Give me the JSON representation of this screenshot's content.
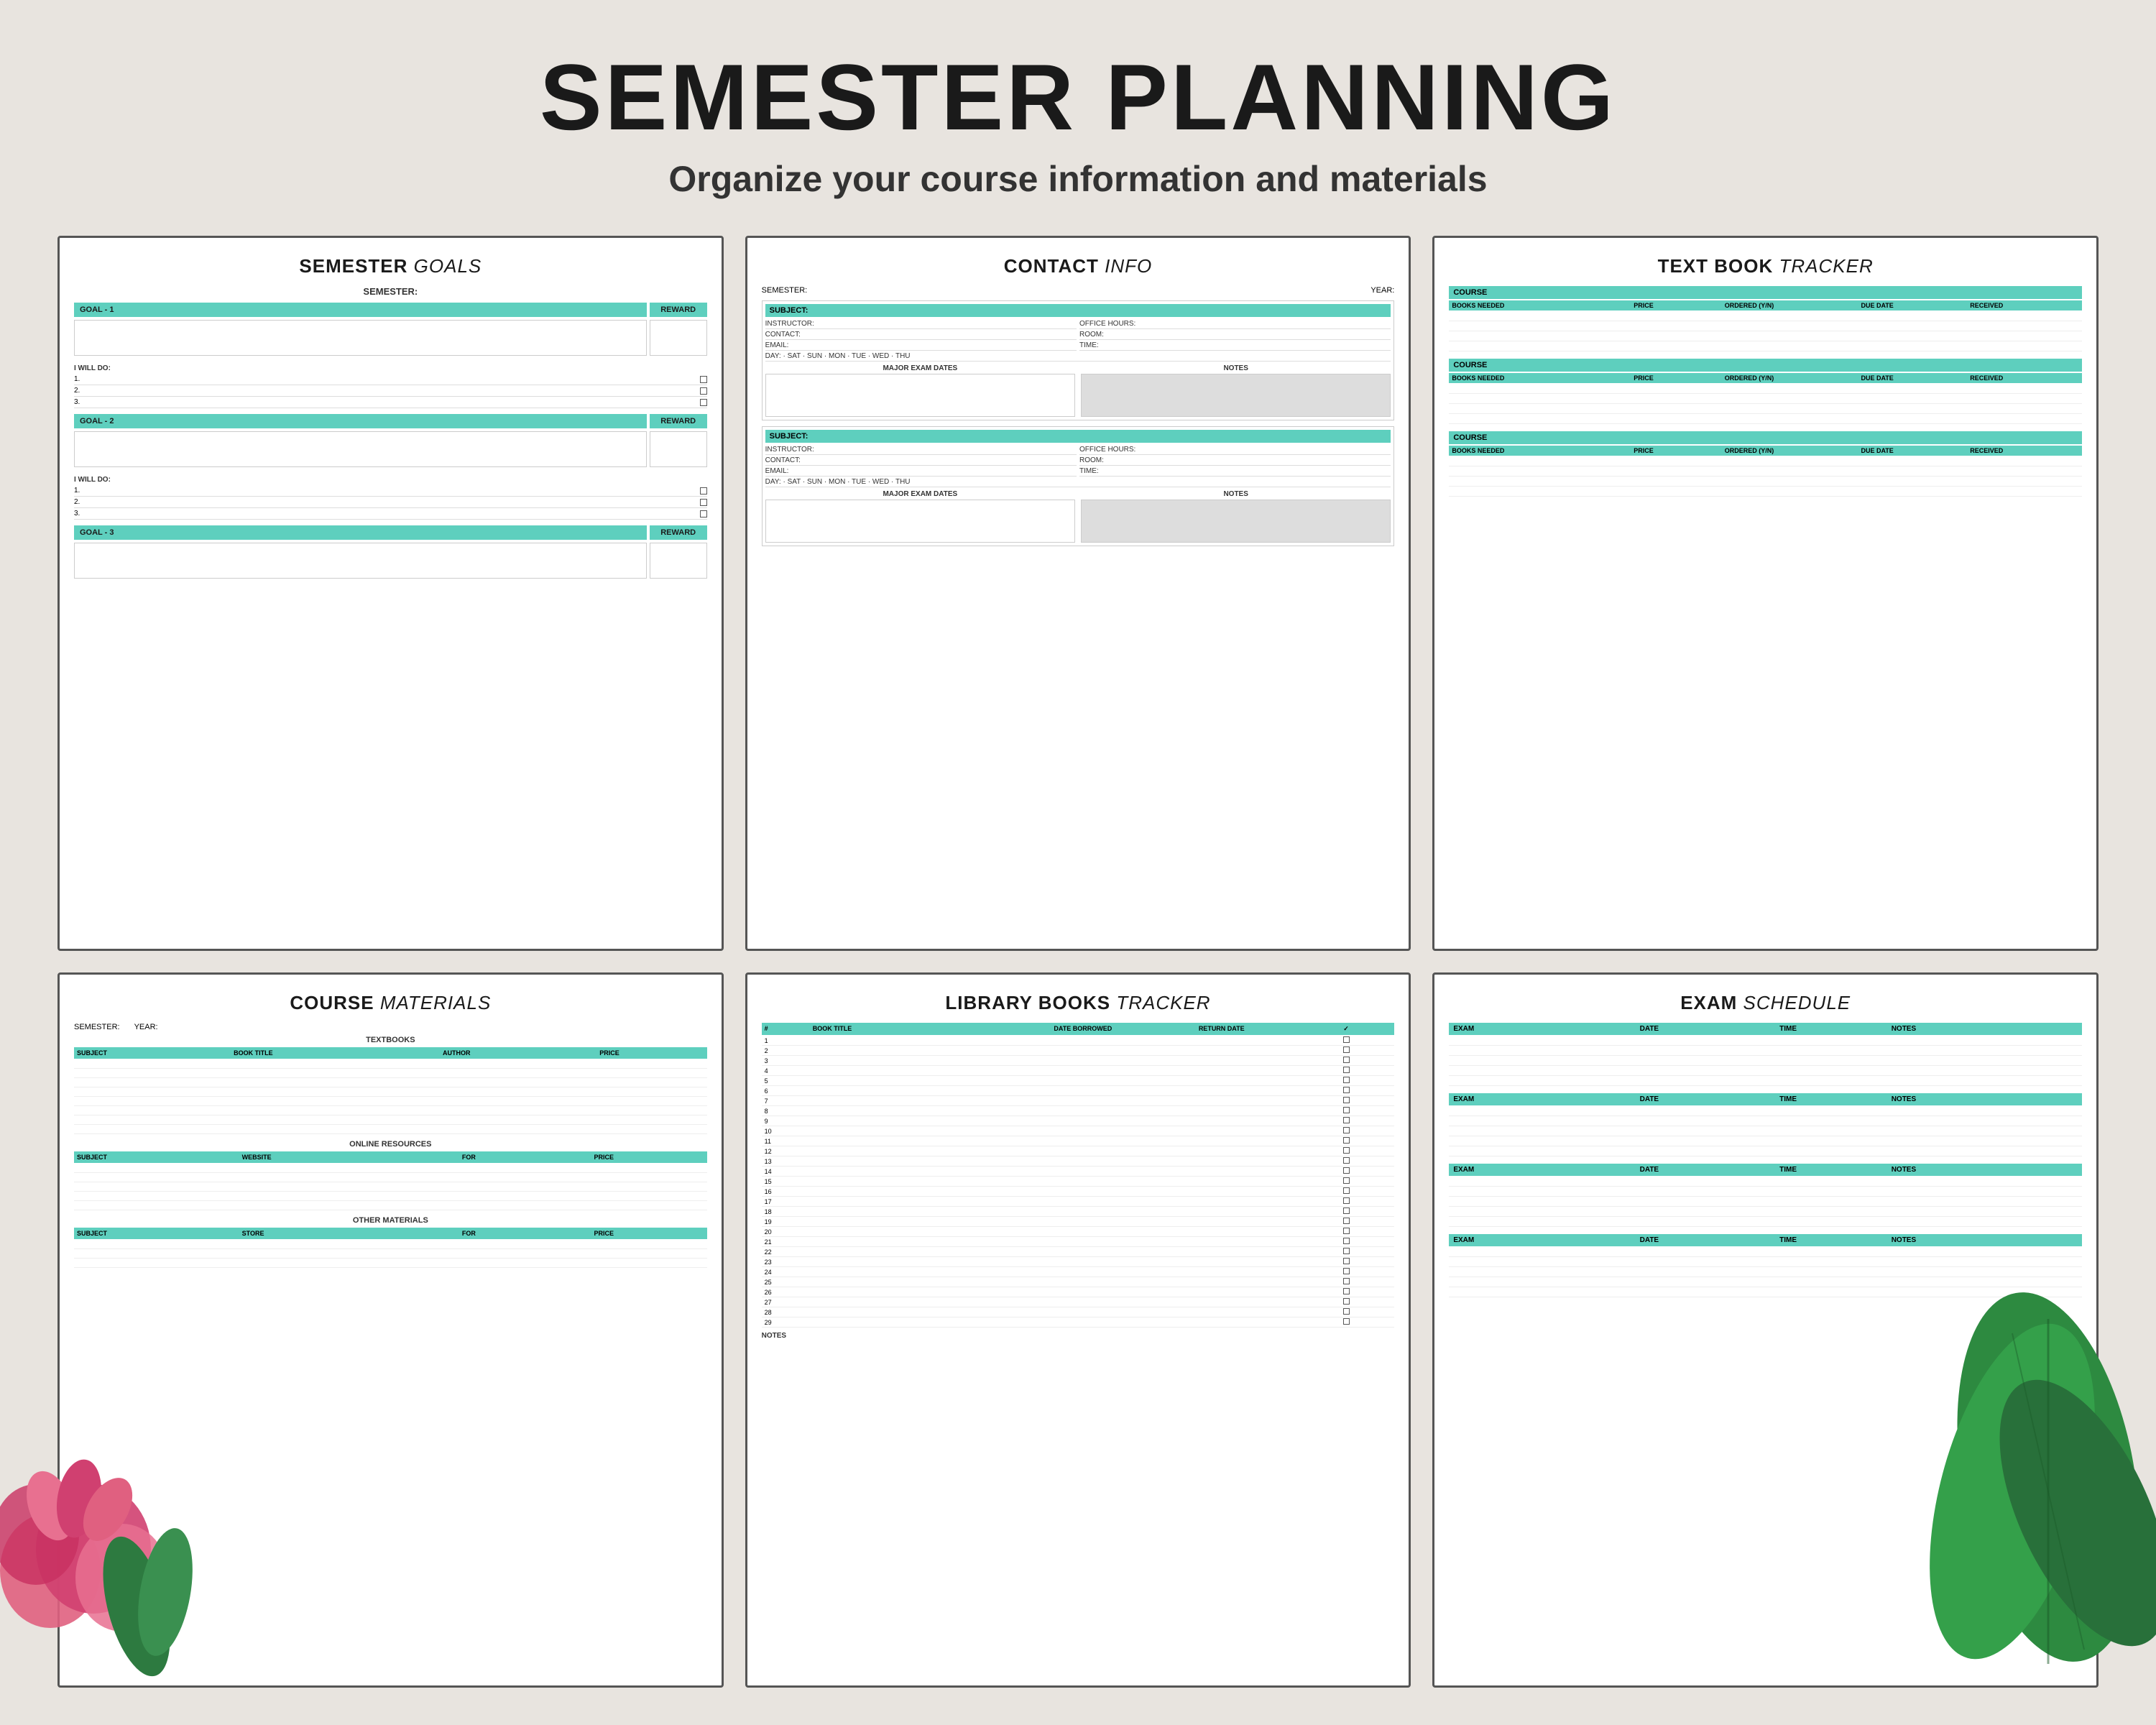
{
  "header": {
    "title": "SEMESTER PLANNING",
    "subtitle": "Organize your course information and materials"
  },
  "pages": {
    "semester_goals": {
      "title": "SEMESTER",
      "title_light": "GOALS",
      "semester_label": "SEMESTER:",
      "goals": [
        {
          "label": "GOAL - 1",
          "reward": "REWARD"
        },
        {
          "label": "GOAL - 2",
          "reward": "REWARD"
        },
        {
          "label": "GOAL - 3",
          "reward": "REWARD"
        }
      ],
      "will_do_label": "I WILL DO:",
      "will_do_items": [
        "1.",
        "2.",
        "3."
      ]
    },
    "contact_info": {
      "title": "CONTACT",
      "title_light": "INFO",
      "semester_label": "SEMESTER:",
      "year_label": "YEAR:",
      "fields": {
        "subject": "SUBJECT:",
        "instructor": "INSTRUCTOR:",
        "contact": "CONTACT:",
        "email": "EMAIL:",
        "office_hours": "OFFICE HOURS:",
        "room": "ROOM:",
        "time": "TIME:",
        "day": "DAY: SAT · SUN · MON · TUE · WED · THU"
      },
      "major_exam_dates": "MAJOR EXAM DATES",
      "notes": "NOTES"
    },
    "text_book_tracker": {
      "title": "TEXT BOOK",
      "title_light": "TRACKER",
      "course_label": "COURSE",
      "headers": [
        "BOOKS NEEDED",
        "PRICE",
        "ORDERED (Y/N)",
        "DUE DATE",
        "RECEIVED"
      ],
      "sections": 3
    },
    "course_materials": {
      "title": "COURSE",
      "title_light": "MATERIALS",
      "semester_label": "SEMESTER:",
      "year_label": "YEAR:",
      "textbooks": {
        "section_title": "TEXTBOOKS",
        "headers": [
          "SUBJECT",
          "BOOK TITLE",
          "AUTHOR",
          "PRICE"
        ],
        "rows": 8
      },
      "online_resources": {
        "section_title": "ONLINE RESOURCES",
        "headers": [
          "SUBJECT",
          "WEBSITE",
          "FOR",
          "PRICE"
        ],
        "rows": 5
      },
      "other_materials": {
        "section_title": "OTHER MATERIALS",
        "headers": [
          "SUBJECT",
          "STORE",
          "FOR",
          "PRICE"
        ],
        "rows": 3
      }
    },
    "library_books": {
      "title": "LIBRARY BOOKS",
      "title_light": "TRACKER",
      "headers": [
        "#",
        "BOOK TITLE",
        "DATE BORROWED",
        "RETURN DATE",
        "✓"
      ],
      "rows": 29,
      "notes_label": "NOTES"
    },
    "exam_schedule": {
      "title": "EXAM",
      "title_light": "SCHEDULE",
      "headers": [
        "EXAM",
        "DATE",
        "TIME",
        "NOTES"
      ],
      "sections": 4,
      "rows_per_section": 5
    }
  }
}
